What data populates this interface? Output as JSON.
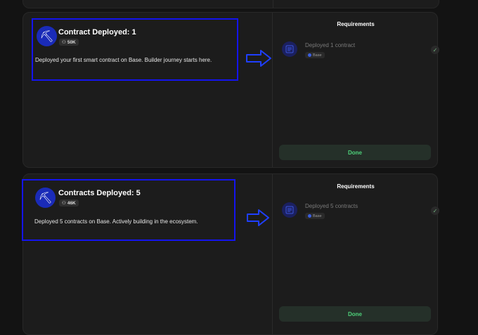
{
  "achievements": [
    {
      "title": "Contract Deployed: 1",
      "xp": "50K",
      "description": "Deployed your first smart contract on Base. Builder journey starts here.",
      "requirements_title": "Requirements",
      "requirement": "Deployed 1 contract",
      "chain": "Base",
      "button": "Done"
    },
    {
      "title": "Contracts Deployed: 5",
      "xp": "46K",
      "description": "Deployed 5 contracts on Base. Actively building in the ecosystem.",
      "requirements_title": "Requirements",
      "requirement": "Deployed 5 contracts",
      "chain": "Base",
      "button": "Done"
    }
  ],
  "colors": {
    "highlight_border": "#1414ee",
    "badge_bg": "#1a2bb8",
    "done_text": "#4ed17a",
    "done_bg": "#253029"
  },
  "icons": {
    "badge": "pickaxe-icon",
    "xp": "xp-icon",
    "requirement": "contract-icon",
    "status": "check-icon",
    "annotation": "arrow-right-icon"
  }
}
